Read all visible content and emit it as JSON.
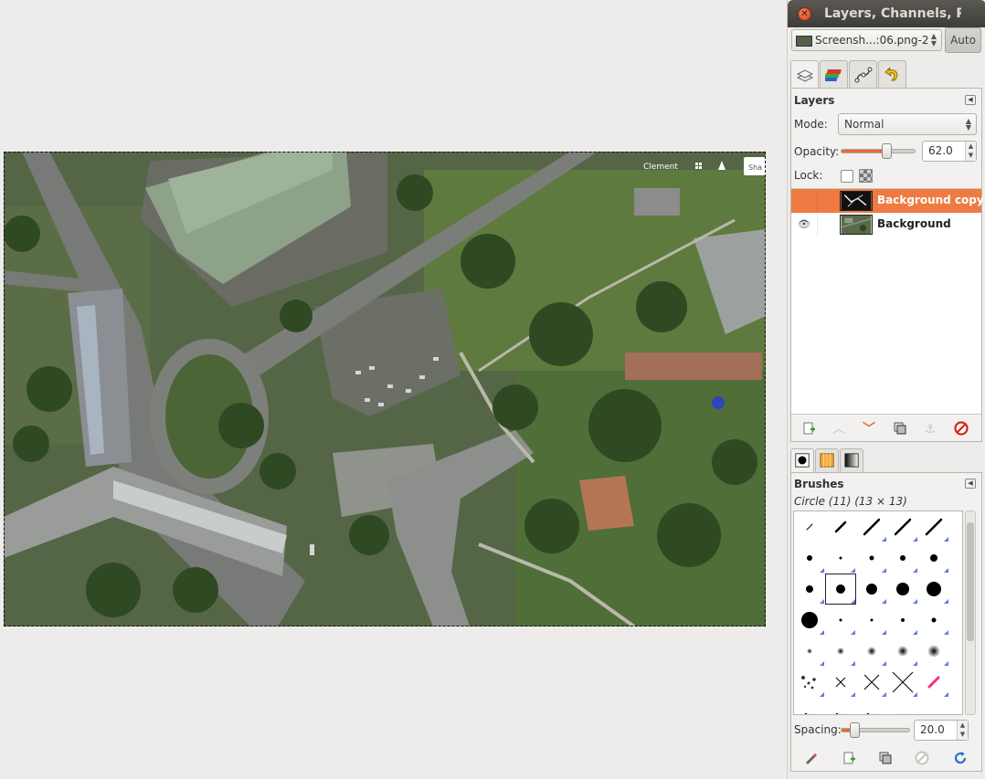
{
  "window": {
    "title": "Layers, Channels, Pa"
  },
  "image_selector": {
    "label": "Screensh...:06.png-2",
    "auto_label": "Auto"
  },
  "dock_tabs": [
    {
      "icon": "layers-tab-icon"
    },
    {
      "icon": "channels-tab-icon"
    },
    {
      "icon": "paths-tab-icon"
    },
    {
      "icon": "undo-history-tab-icon"
    }
  ],
  "layers_panel": {
    "title": "Layers",
    "mode_label": "Mode:",
    "mode_value": "Normal",
    "opacity_label": "Opacity:",
    "opacity_value": "62.0",
    "opacity_fraction": 0.62,
    "lock_label": "Lock:",
    "layers": [
      {
        "name": "Background copy",
        "selected": true,
        "visible": false
      },
      {
        "name": "Background",
        "selected": false,
        "visible": true
      }
    ],
    "toolbar": [
      "new-layer-icon",
      "raise-layer-icon",
      "lower-layer-icon",
      "duplicate-layer-icon",
      "anchor-layer-icon",
      "delete-layer-icon"
    ]
  },
  "brushes_panel": {
    "title": "Brushes",
    "selected_brush": "Circle (11) (13 × 13)",
    "spacing_label": "Spacing:",
    "spacing_value": "20.0",
    "spacing_fraction": 0.2,
    "toolbar": [
      "edit-brush-icon",
      "new-brush-icon",
      "duplicate-brush-icon",
      "delete-brush-icon",
      "refresh-brushes-icon"
    ]
  },
  "map_labels": {
    "place": "Clement",
    "share": "Sha"
  },
  "colors": {
    "accent": "#ef7b42",
    "title_bar": "#3d3c38"
  }
}
